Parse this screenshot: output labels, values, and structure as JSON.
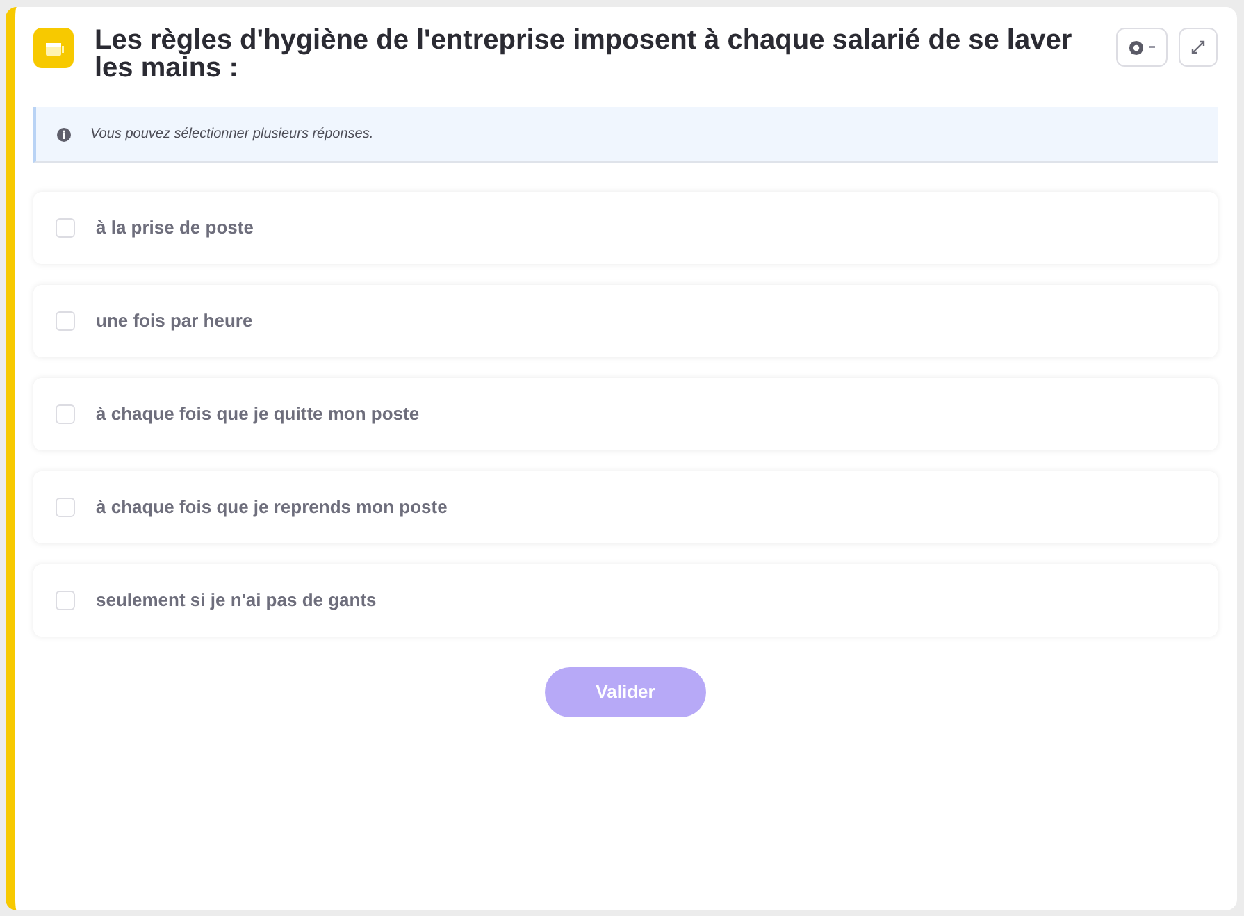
{
  "question": {
    "title": "Les règles d'hygiène de l'entreprise imposent à chaque salarié de se laver les mains :"
  },
  "hint": "Vous pouvez sélectionner plusieurs réponses.",
  "options": [
    {
      "label": "à la prise de poste",
      "checked": false
    },
    {
      "label": "une fois par heure",
      "checked": false
    },
    {
      "label": "à chaque fois que je quitte mon poste",
      "checked": false
    },
    {
      "label": "à chaque fois que je reprends mon poste",
      "checked": false
    },
    {
      "label": "seulement si je n'ai pas de gants",
      "checked": false
    }
  ],
  "submit": {
    "label": "Valider",
    "disabled": true
  }
}
